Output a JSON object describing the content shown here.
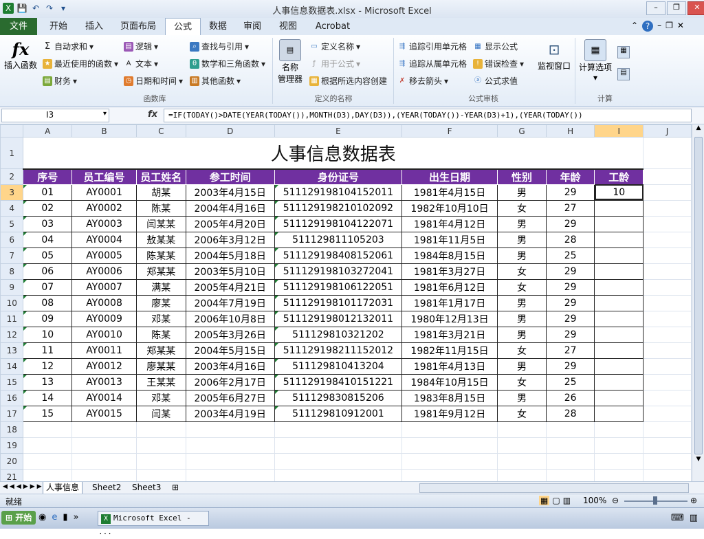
{
  "window": {
    "title": "人事信息数据表.xlsx  -  Microsoft Excel",
    "controls": [
      "–",
      "❐",
      "✕"
    ],
    "quick_access": [
      "💾",
      "↶",
      "↷",
      "▾"
    ]
  },
  "ribbon_tabs": {
    "file": "文件",
    "tabs": [
      "开始",
      "插入",
      "页面布局",
      "公式",
      "数据",
      "审阅",
      "视图",
      "Acrobat"
    ],
    "active": "公式"
  },
  "ribbon": {
    "insert_function": "插入函数",
    "fx_glyph": "fx",
    "library": {
      "autosum": "自动求和",
      "recent": "最近使用的函数",
      "finance": "财务",
      "logic": "逻辑",
      "text": "文本",
      "datetime": "日期和时间",
      "lookup": "查找与引用",
      "math": "数学和三角函数",
      "other": "其他函数",
      "group_label": "函数库"
    },
    "names": {
      "name_manager_line1": "名称",
      "name_manager_line2": "管理器",
      "define_name": "定义名称",
      "use_in_formula": "用于公式",
      "create_from_selection": "根据所选内容创建",
      "group_label": "定义的名称"
    },
    "audit": {
      "trace_precedents": "追踪引用单元格",
      "trace_dependents": "追踪从属单元格",
      "remove_arrows": "移去箭头",
      "show_formulas": "显示公式",
      "error_check": "错误检查",
      "evaluate": "公式求值",
      "watch_window": "监视窗口",
      "group_label": "公式审核"
    },
    "calc": {
      "options": "计算选项",
      "group_label": "计算"
    }
  },
  "formula_bar": {
    "name_box": "I3",
    "fx": "fx",
    "formula": "=IF(TODAY()>DATE(YEAR(TODAY()),MONTH(D3),DAY(D3)),(YEAR(TODAY())-YEAR(D3)+1),(YEAR(TODAY())"
  },
  "columns": [
    "A",
    "B",
    "C",
    "D",
    "E",
    "F",
    "G",
    "H",
    "I",
    "J"
  ],
  "rows": [
    "1",
    "2",
    "3",
    "4",
    "5",
    "6",
    "7",
    "8",
    "9",
    "10",
    "11",
    "12",
    "13",
    "14",
    "15",
    "16",
    "17",
    "18",
    "19",
    "20",
    "21",
    "22"
  ],
  "sheet": {
    "title": "人事信息数据表",
    "headers": [
      "序号",
      "员工编号",
      "员工姓名",
      "参工时间",
      "身份证号",
      "出生日期",
      "性别",
      "年龄",
      "工龄"
    ],
    "data": [
      [
        "01",
        "AY0001",
        "胡某",
        "2003年4月15日",
        "511129198104152011",
        "1981年4月15日",
        "男",
        "29",
        "10"
      ],
      [
        "02",
        "AY0002",
        "陈某",
        "2004年4月16日",
        "511129198210102092",
        "1982年10月10日",
        "女",
        "27",
        ""
      ],
      [
        "03",
        "AY0003",
        "闫某某",
        "2005年4月20日",
        "511129198104122071",
        "1981年4月12日",
        "男",
        "29",
        ""
      ],
      [
        "04",
        "AY0004",
        "敖某某",
        "2006年3月12日",
        "511129811105203",
        "1981年11月5日",
        "男",
        "28",
        ""
      ],
      [
        "05",
        "AY0005",
        "陈某某",
        "2004年5月18日",
        "511129198408152061",
        "1984年8月15日",
        "男",
        "25",
        ""
      ],
      [
        "06",
        "AY0006",
        "郑某某",
        "2003年5月10日",
        "511129198103272041",
        "1981年3月27日",
        "女",
        "29",
        ""
      ],
      [
        "07",
        "AY0007",
        "满某",
        "2005年4月21日",
        "511129198106122051",
        "1981年6月12日",
        "女",
        "29",
        ""
      ],
      [
        "08",
        "AY0008",
        "廖某",
        "2004年7月19日",
        "511129198101172031",
        "1981年1月17日",
        "男",
        "29",
        ""
      ],
      [
        "09",
        "AY0009",
        "邓某",
        "2006年10月8日",
        "511129198012132011",
        "1980年12月13日",
        "男",
        "29",
        ""
      ],
      [
        "10",
        "AY0010",
        "陈某",
        "2005年3月26日",
        "511129810321202",
        "1981年3月21日",
        "男",
        "29",
        ""
      ],
      [
        "11",
        "AY0011",
        "郑某某",
        "2004年5月15日",
        "511129198211152012",
        "1982年11月15日",
        "女",
        "27",
        ""
      ],
      [
        "12",
        "AY0012",
        "廖某某",
        "2003年4月16日",
        "511129810413204",
        "1981年4月13日",
        "男",
        "29",
        ""
      ],
      [
        "13",
        "AY0013",
        "王某某",
        "2006年2月17日",
        "511129198410151221",
        "1984年10月15日",
        "女",
        "25",
        ""
      ],
      [
        "14",
        "AY0014",
        "邓某",
        "2005年6月27日",
        "511129830815206",
        "1983年8月15日",
        "男",
        "26",
        ""
      ],
      [
        "15",
        "AY0015",
        "闫某",
        "2003年4月19日",
        "511129810912001",
        "1981年9月12日",
        "女",
        "28",
        ""
      ]
    ]
  },
  "sheet_tabs": [
    "人事信息",
    "Sheet2",
    "Sheet3"
  ],
  "status": {
    "ready": "就绪",
    "zoom": "100%"
  },
  "taskbar": {
    "start": "开始",
    "app": "Microsoft Excel - ..."
  }
}
